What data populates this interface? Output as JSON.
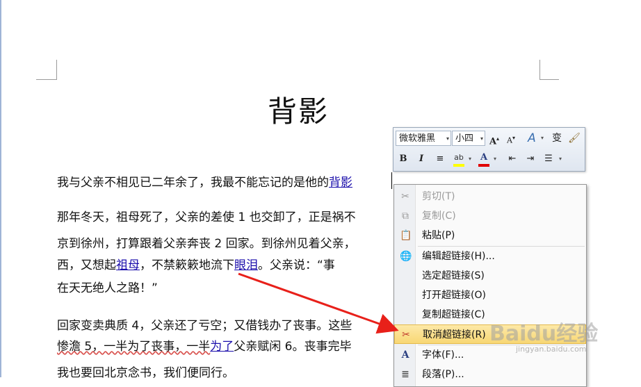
{
  "document": {
    "title": "背影",
    "p1": {
      "before": "我与父亲不相见已二年余了，我最不能忘记的是他的",
      "link": "背影"
    },
    "p2": {
      "line1": "那年冬天，祖母死了，父亲的差使 1 也交卸了，正是祸不",
      "line2": "京到徐州，打算跟着父亲奔丧 2 回家。到徐州见着父亲，",
      "line3_a": "西，又想起",
      "line3_link1": "祖母",
      "line3_b": "，不禁簌簌地流下",
      "line3_link2": "眼泪",
      "line3_c": "。父亲说：“事",
      "line4": "在天无绝人之路！”"
    },
    "p3": {
      "line1": "回家变卖典质 4，父亲还了亏空；又借钱办了丧事。这些",
      "line2_a": "惨澹 5，一半为了丧事，一半",
      "line2_link": "为了",
      "line2_b": "父亲赋闲 6。丧事完毕",
      "line3": "我也要回北京念书，我们便同行。"
    }
  },
  "mini_toolbar": {
    "font_name": "微软雅黑",
    "font_size": "小四",
    "buttons": [
      "grow-font",
      "shrink-font",
      "styles",
      "phonetic",
      "format-painter",
      "bold",
      "italic",
      "center",
      "highlight",
      "font-color",
      "decrease-indent",
      "increase-indent",
      "bullets"
    ],
    "bold": "B",
    "italic": "I",
    "grow": "A",
    "shrink": "A",
    "styles": "A",
    "phonetic": "变",
    "font_color_letter": "A",
    "highlight_color": "#ffff00",
    "font_color": "#e00000"
  },
  "context_menu": {
    "items": [
      {
        "label": "剪切(T)",
        "icon": "scissors-icon",
        "enabled": false
      },
      {
        "label": "复制(C)",
        "icon": "copy-icon",
        "enabled": false
      },
      {
        "label": "粘贴(P)",
        "icon": "paste-icon",
        "enabled": true
      },
      {
        "label": "编辑超链接(H)...",
        "icon": "globe-link-icon",
        "enabled": true
      },
      {
        "label": "选定超链接(S)",
        "icon": "",
        "enabled": true
      },
      {
        "label": "打开超链接(O)",
        "icon": "",
        "enabled": true
      },
      {
        "label": "复制超链接(C)",
        "icon": "",
        "enabled": true
      },
      {
        "label": "取消超链接(R)",
        "icon": "remove-link-icon",
        "enabled": true,
        "highlighted": true
      },
      {
        "label": "字体(F)...",
        "icon": "font-icon",
        "enabled": true
      },
      {
        "label": "段落(P)...",
        "icon": "paragraph-icon",
        "enabled": true
      }
    ]
  },
  "watermark": {
    "brand": "Baidu经验",
    "url": "jingyan.baidu.com"
  },
  "colors": {
    "link": "#1a0dab",
    "arrow": "#e8201a",
    "highlight": "#f8d774"
  }
}
